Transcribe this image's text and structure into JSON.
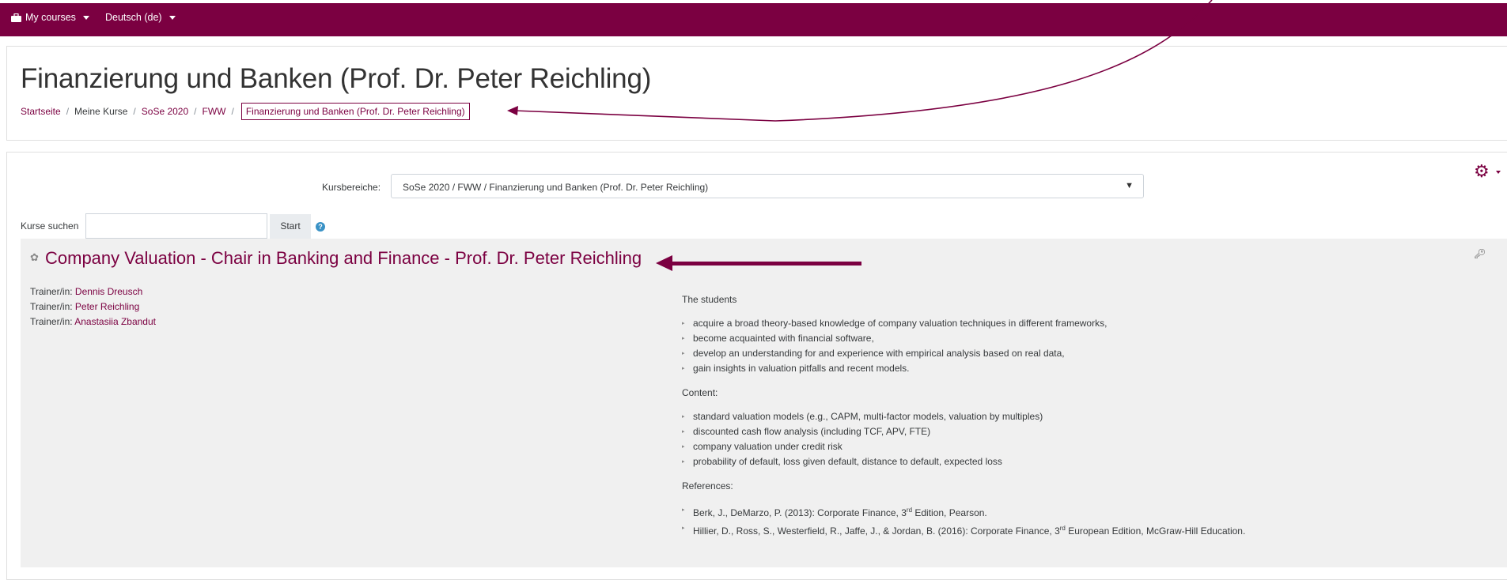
{
  "nav": {
    "my_courses": "My courses",
    "language": "Deutsch (de)"
  },
  "page": {
    "title": "Finanzierung und Banken (Prof. Dr. Peter Reichling)",
    "breadcrumb": [
      "Startseite",
      "Meine Kurse",
      "SoSe 2020",
      "FWW",
      "Finanzierung und Banken (Prof. Dr. Peter Reichling)"
    ]
  },
  "filter": {
    "kursbereiche_label": "Kursbereiche:",
    "kursbereiche_value": "SoSe 2020 / FWW / Finanzierung und Banken (Prof. Dr. Peter Reichling)",
    "search_label": "Kurse suchen",
    "search_placeholder": "",
    "start_label": "Start"
  },
  "course": {
    "title": "Company Valuation - Chair in Banking and Finance - Prof. Dr. Peter Reichling",
    "teacher_prefix": "Trainer/in: ",
    "teachers": [
      "Dennis Dreusch",
      "Peter Reichling",
      "Anastasiia Zbandut"
    ],
    "summary": {
      "intro": "The students",
      "goals": [
        "acquire a broad theory-based knowledge of company valuation techniques in different frameworks,",
        "become acquainted with financial software,",
        "develop an understanding for and experience with empirical analysis based on real data,",
        "gain insights in valuation pitfalls and recent models."
      ],
      "content_heading": "Content:",
      "content": [
        "standard valuation models (e.g., CAPM, multi-factor models, valuation by multiples)",
        "discounted cash flow analysis (including TCF, APV, FTE)",
        "company valuation under credit risk",
        "probability of default, loss given default, distance to default, expected loss"
      ],
      "references_heading": "References:",
      "ref1_a": "Berk, J., DeMarzo, P. (2013): Corporate Finance, 3",
      "ref1_sup": "rd",
      "ref1_b": " Edition, Pearson.",
      "ref2_a": "Hillier, D., Ross, S., Westerfield, R., Jaffe, J., & Jordan, B. (2016): Corporate Finance, 3",
      "ref2_sup": "rd",
      "ref2_b": " European Edition, McGraw-Hill Education."
    }
  },
  "icons": {
    "gear": "gear-icon",
    "key": "key-icon",
    "help": "help-icon",
    "course": "course-icon",
    "caret": "caret-down-icon"
  },
  "colors": {
    "brand": "#7b0041",
    "link": "#7b0041",
    "help": "#3a92c6"
  }
}
